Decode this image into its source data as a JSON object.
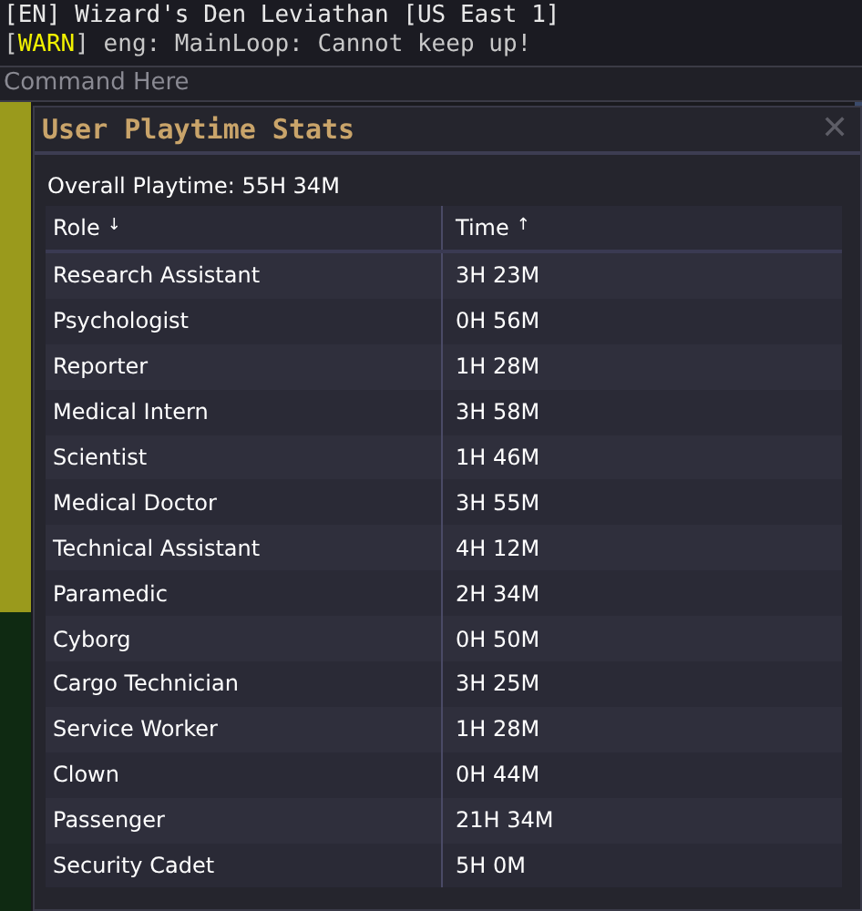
{
  "console": {
    "lines": [
      {
        "kind": "plain",
        "text": "[EN] Wizard's Den Leviathan [US East 1]"
      },
      {
        "kind": "warn",
        "prefix": "[",
        "level_tag": "WARN",
        "suffix": "] eng: MainLoop: Cannot keep up!"
      }
    ],
    "command": {
      "placeholder": "Command Here"
    }
  },
  "window": {
    "title": "User Playtime Stats",
    "close": "✕"
  },
  "overall": "Overall Playtime: 55H 34M",
  "table": {
    "columns": [
      {
        "label": "Role",
        "sort_arrow": "↓"
      },
      {
        "label": "Time",
        "sort_arrow": "↑"
      }
    ],
    "rows": [
      [
        "Research Assistant",
        "3H 23M"
      ],
      [
        "Psychologist",
        "0H 56M"
      ],
      [
        "Reporter",
        "1H 28M"
      ],
      [
        "Medical Intern",
        "3H 58M"
      ],
      [
        "Scientist",
        "1H 46M"
      ],
      [
        "Medical Doctor",
        "3H 55M"
      ],
      [
        "Technical Assistant",
        "4H 12M"
      ],
      [
        "Paramedic",
        "2H 34M"
      ],
      [
        "Cyborg",
        "0H 50M"
      ],
      [
        "Cargo Technician",
        "3H 25M"
      ],
      [
        "Service Worker",
        "1H 28M"
      ],
      [
        "Clown",
        "0H 44M"
      ],
      [
        "Passenger",
        "21H 34M"
      ],
      [
        "Security Cadet",
        "5H 0M"
      ]
    ]
  }
}
